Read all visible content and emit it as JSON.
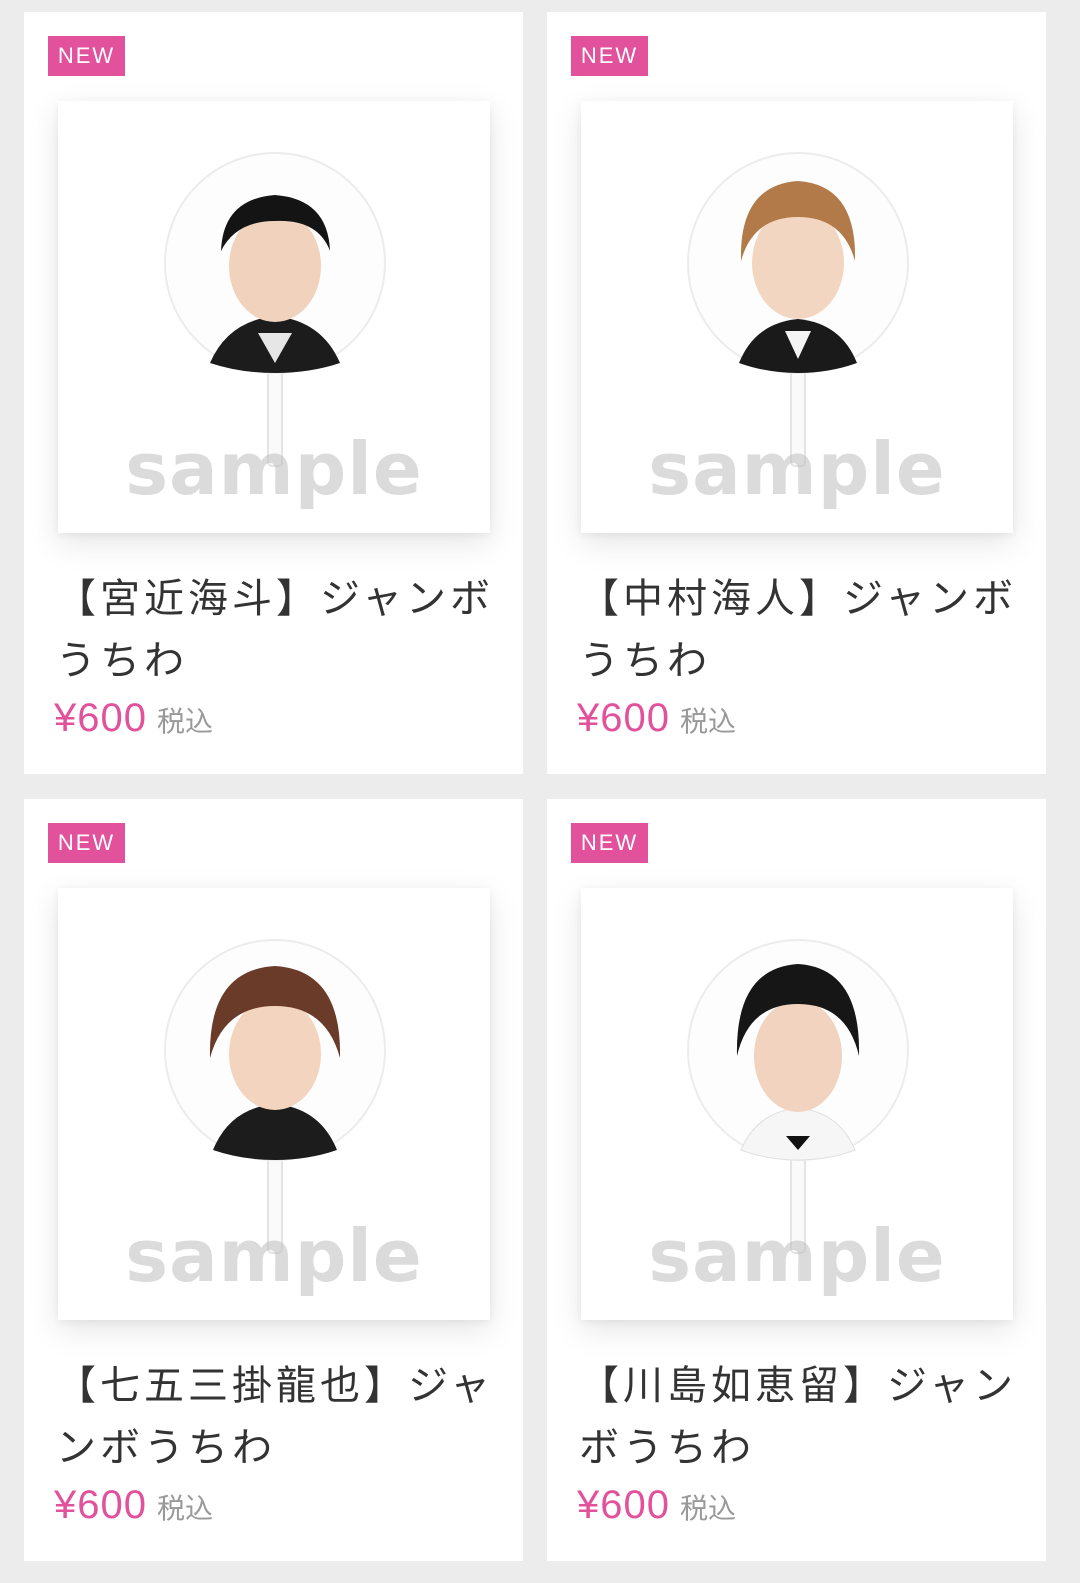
{
  "colors": {
    "accent": "#e2519b",
    "background": "#ececec",
    "card": "#ffffff",
    "text": "#333333",
    "muted": "#999999"
  },
  "products": [
    {
      "badge": "NEW",
      "name": "【宮近海斗】ジャンボうちわ",
      "price": "¥600",
      "tax_label": "税込",
      "watermark": "sample",
      "image_icon": "uchiwa-fan-photo-icon"
    },
    {
      "badge": "NEW",
      "name": "【中村海人】ジャンボうちわ",
      "price": "¥600",
      "tax_label": "税込",
      "watermark": "sample",
      "image_icon": "uchiwa-fan-photo-icon"
    },
    {
      "badge": "NEW",
      "name": "【七五三掛龍也】ジャンボうちわ",
      "price": "¥600",
      "tax_label": "税込",
      "watermark": "sample",
      "image_icon": "uchiwa-fan-photo-icon"
    },
    {
      "badge": "NEW",
      "name": "【川島如恵留】ジャンボうちわ",
      "price": "¥600",
      "tax_label": "税込",
      "watermark": "sample",
      "image_icon": "uchiwa-fan-photo-icon"
    }
  ]
}
